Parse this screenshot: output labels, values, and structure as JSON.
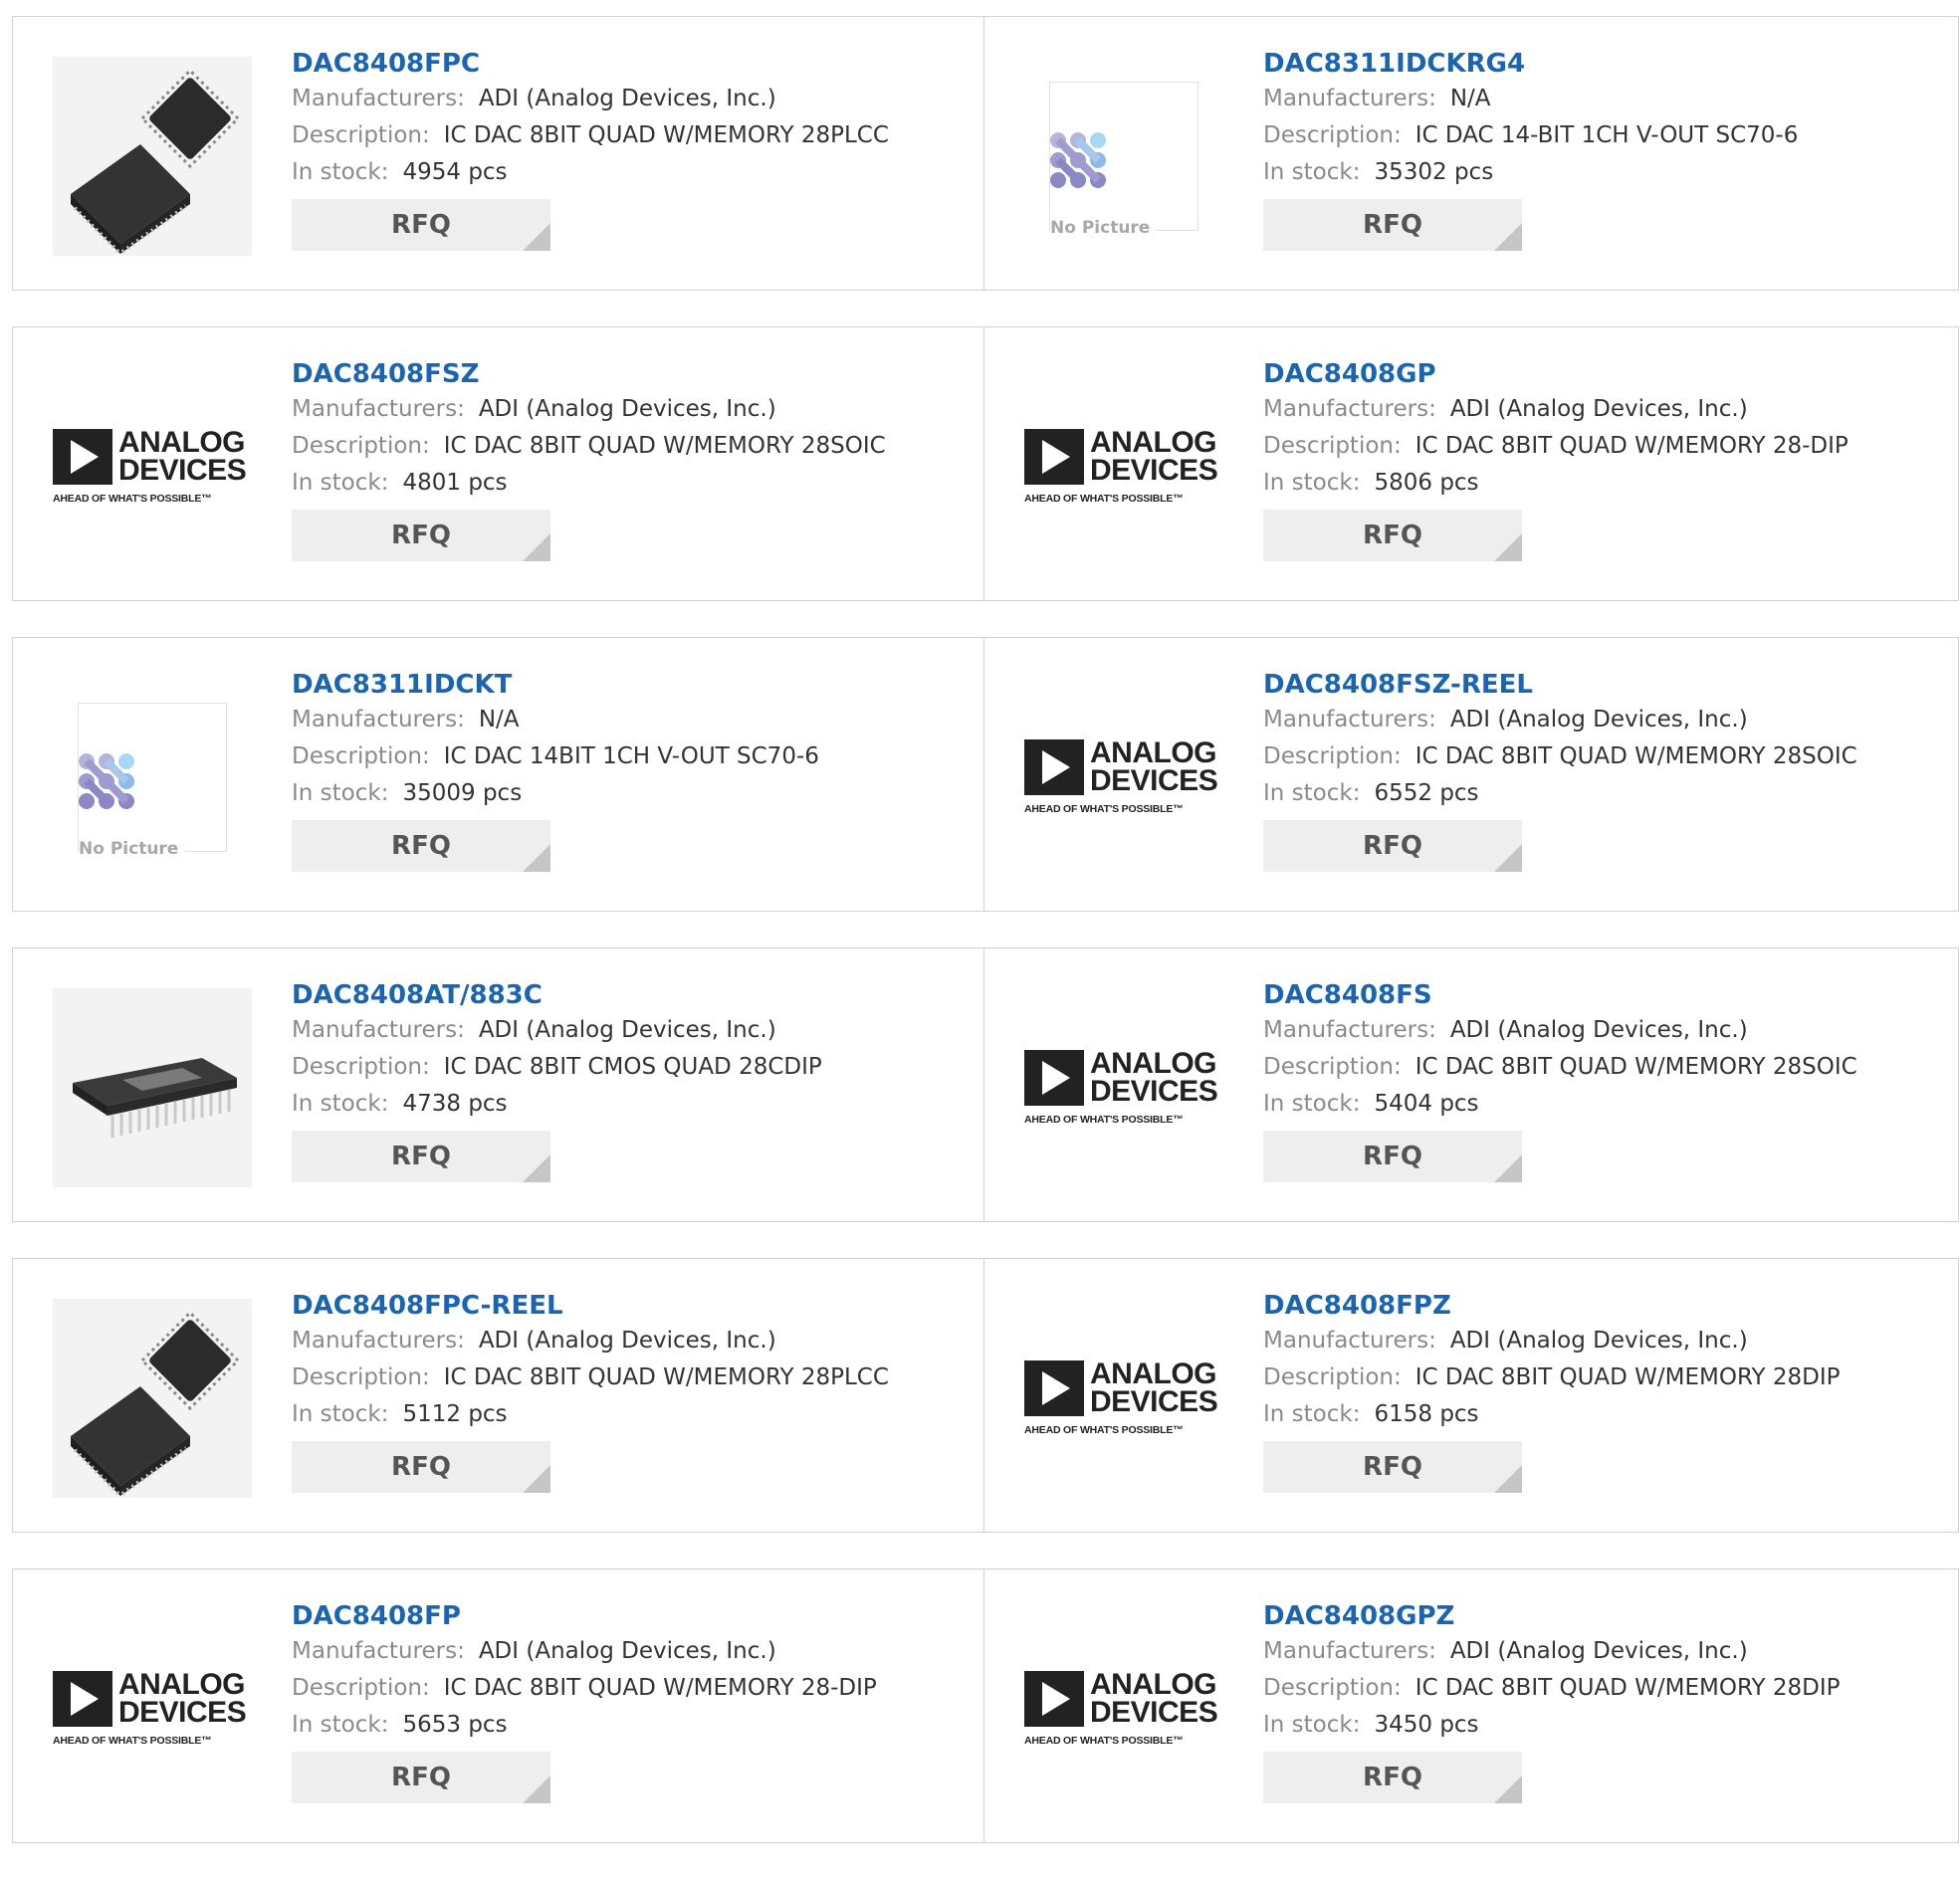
{
  "labels": {
    "manufacturers": "Manufacturers:",
    "description": "Description:",
    "in_stock": "In stock:",
    "rfq": "RFQ",
    "no_picture": "No Picture",
    "adi_word1": "ANALOG",
    "adi_word2": "DEVICES",
    "adi_tagline": "AHEAD OF WHAT'S POSSIBLE™"
  },
  "colors": {
    "part_link": "#1a64b4",
    "label_gray": "#8a8a8a",
    "rfq_bg": "#eeeeee"
  },
  "products": [
    {
      "part": "DAC8408FPC",
      "manufacturer": "ADI (Analog Devices, Inc.)",
      "description": "IC DAC 8BIT QUAD W/MEMORY 28PLCC",
      "stock": "4954 pcs",
      "image": "plcc-chip"
    },
    {
      "part": "DAC8311IDCKRG4",
      "manufacturer": "N/A",
      "description": "IC DAC 14-BIT 1CH V-OUT SC70-6",
      "stock": "35302 pcs",
      "image": "no-picture"
    },
    {
      "part": "DAC8408FSZ",
      "manufacturer": "ADI (Analog Devices, Inc.)",
      "description": "IC DAC 8BIT QUAD W/MEMORY 28SOIC",
      "stock": "4801 pcs",
      "image": "adi-logo"
    },
    {
      "part": "DAC8408GP",
      "manufacturer": "ADI (Analog Devices, Inc.)",
      "description": "IC DAC 8BIT QUAD W/MEMORY 28-DIP",
      "stock": "5806 pcs",
      "image": "adi-logo"
    },
    {
      "part": "DAC8311IDCKT",
      "manufacturer": "N/A",
      "description": "IC DAC 14BIT 1CH V-OUT SC70-6",
      "stock": "35009 pcs",
      "image": "no-picture"
    },
    {
      "part": "DAC8408FSZ-REEL",
      "manufacturer": "ADI (Analog Devices, Inc.)",
      "description": "IC DAC 8BIT QUAD W/MEMORY 28SOIC",
      "stock": "6552 pcs",
      "image": "adi-logo"
    },
    {
      "part": "DAC8408AT/883C",
      "manufacturer": "ADI (Analog Devices, Inc.)",
      "description": "IC DAC 8BIT CMOS QUAD 28CDIP",
      "stock": "4738 pcs",
      "image": "dip-chip"
    },
    {
      "part": "DAC8408FS",
      "manufacturer": "ADI (Analog Devices, Inc.)",
      "description": "IC DAC 8BIT QUAD W/MEMORY 28SOIC",
      "stock": "5404 pcs",
      "image": "adi-logo"
    },
    {
      "part": "DAC8408FPC-REEL",
      "manufacturer": "ADI (Analog Devices, Inc.)",
      "description": "IC DAC 8BIT QUAD W/MEMORY 28PLCC",
      "stock": "5112 pcs",
      "image": "plcc-chip"
    },
    {
      "part": "DAC8408FPZ",
      "manufacturer": "ADI (Analog Devices, Inc.)",
      "description": "IC DAC 8BIT QUAD W/MEMORY 28DIP",
      "stock": "6158 pcs",
      "image": "adi-logo"
    },
    {
      "part": "DAC8408FP",
      "manufacturer": "ADI (Analog Devices, Inc.)",
      "description": "IC DAC 8BIT QUAD W/MEMORY 28-DIP",
      "stock": "5653 pcs",
      "image": "adi-logo"
    },
    {
      "part": "DAC8408GPZ",
      "manufacturer": "ADI (Analog Devices, Inc.)",
      "description": "IC DAC 8BIT QUAD W/MEMORY 28DIP",
      "stock": "3450 pcs",
      "image": "adi-logo"
    }
  ]
}
